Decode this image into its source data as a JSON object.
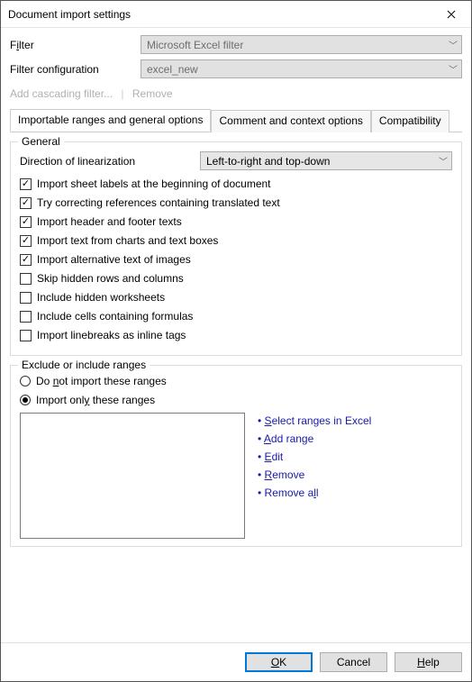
{
  "window": {
    "title": "Document import settings"
  },
  "filter": {
    "label_pre": "F",
    "label_acc": "i",
    "label_post": "lter",
    "value": "Microsoft Excel filter"
  },
  "filter_config": {
    "label": "Filter configuration",
    "value": "excel_new"
  },
  "links": {
    "add_cascading": "Add cascading filter...",
    "remove": "Remove"
  },
  "tabs": {
    "t1": "Importable ranges and general options",
    "t2": "Comment and context options",
    "t3": "Compatibility"
  },
  "general": {
    "legend": "General",
    "linearization_label": "Direction of linearization",
    "linearization_value": "Left-to-right and top-down",
    "opts": {
      "o1": "Import sheet labels at the beginning of document",
      "o2": "Try correcting references containing translated text",
      "o3": "Import header and footer texts",
      "o4": "Import text from charts and text boxes",
      "o5": "Import alternative text of images",
      "o6": "Skip hidden rows and columns",
      "o7": "Include hidden worksheets",
      "o8": "Include cells containing formulas",
      "o9": "Import linebreaks as inline tags"
    }
  },
  "ranges": {
    "legend": "Exclude or include ranges",
    "r1_pre": "Do ",
    "r1_acc": "n",
    "r1_post": "ot import these ranges",
    "r2_pre": "Import onl",
    "r2_acc": "y",
    "r2_post": " these ranges",
    "actions": {
      "a1_acc": "S",
      "a1_post": "elect ranges in Excel",
      "a2_acc": "A",
      "a2_post": "dd range",
      "a3_acc": "E",
      "a3_post": "dit",
      "a4_acc": "R",
      "a4_post": "emove",
      "a5_pre": "Remove a",
      "a5_acc": "l",
      "a5_post": "l"
    }
  },
  "footer": {
    "ok_acc": "O",
    "ok_post": "K",
    "cancel": "Cancel",
    "help_acc": "H",
    "help_post": "elp"
  }
}
